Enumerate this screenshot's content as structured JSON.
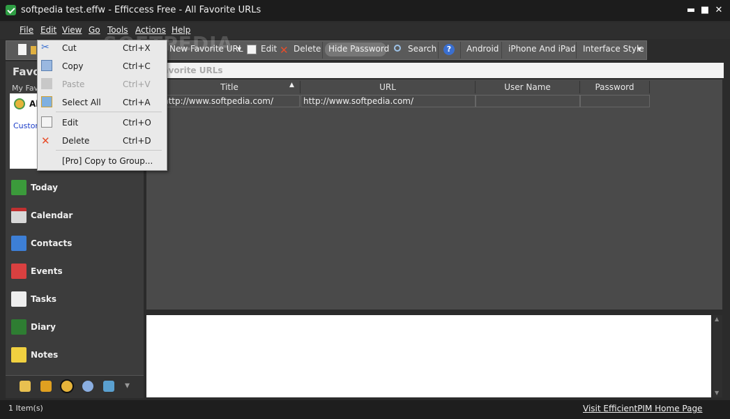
{
  "window": {
    "title": "softpedia test.effw - Efficcess Free - All Favorite URLs",
    "minimize": "▬",
    "maximize": "■",
    "close": "✕"
  },
  "menubar": {
    "items": [
      "File",
      "Edit",
      "View",
      "Go",
      "Tools",
      "Actions",
      "Help"
    ]
  },
  "toolbar": {
    "new_favorite_url": "New Favorite URL",
    "edit": "Edit",
    "delete": "Delete",
    "hide_password": "Hide Password",
    "search": "Search",
    "android": "Android",
    "iphone_ipad": "iPhone And iPad",
    "interface_style": "Interface Style",
    "dropdown_arrow": "▾"
  },
  "sidebar": {
    "title": "Favo",
    "subtitle": "My Favo",
    "selected_item": "Al",
    "custom_item": "Custom",
    "nav": [
      "Today",
      "Calendar",
      "Contacts",
      "Events",
      "Tasks",
      "Diary",
      "Notes"
    ],
    "more_arrow": "▾"
  },
  "grid": {
    "header_title": "Favorite URLs",
    "columns": [
      "Title",
      "URL",
      "User Name",
      "Password"
    ],
    "sort_indicator": "▲",
    "rows": [
      {
        "title": "http://www.softpedia.com/",
        "url": "http://www.softpedia.com/",
        "user": "",
        "password": ""
      }
    ]
  },
  "context_menu": {
    "items": [
      {
        "label": "Cut",
        "shortcut": "Ctrl+X"
      },
      {
        "label": "Copy",
        "shortcut": "Ctrl+C"
      },
      {
        "label": "Paste",
        "shortcut": "Ctrl+V"
      },
      {
        "label": "Select All",
        "shortcut": "Ctrl+A"
      },
      {
        "label": "Edit",
        "shortcut": "Ctrl+O"
      },
      {
        "label": "Delete",
        "shortcut": "Ctrl+D"
      },
      {
        "label": "[Pro] Copy to Group...",
        "shortcut": ""
      }
    ]
  },
  "statusbar": {
    "count": "1 Item(s)",
    "link": "Visit EfficientPIM Home Page"
  },
  "watermark": "SOFTPEDIA",
  "colors": {
    "accent_green": "#2f9e44",
    "titlebar": "#1c1c1c",
    "menu_bg": "#e9e9e9"
  }
}
